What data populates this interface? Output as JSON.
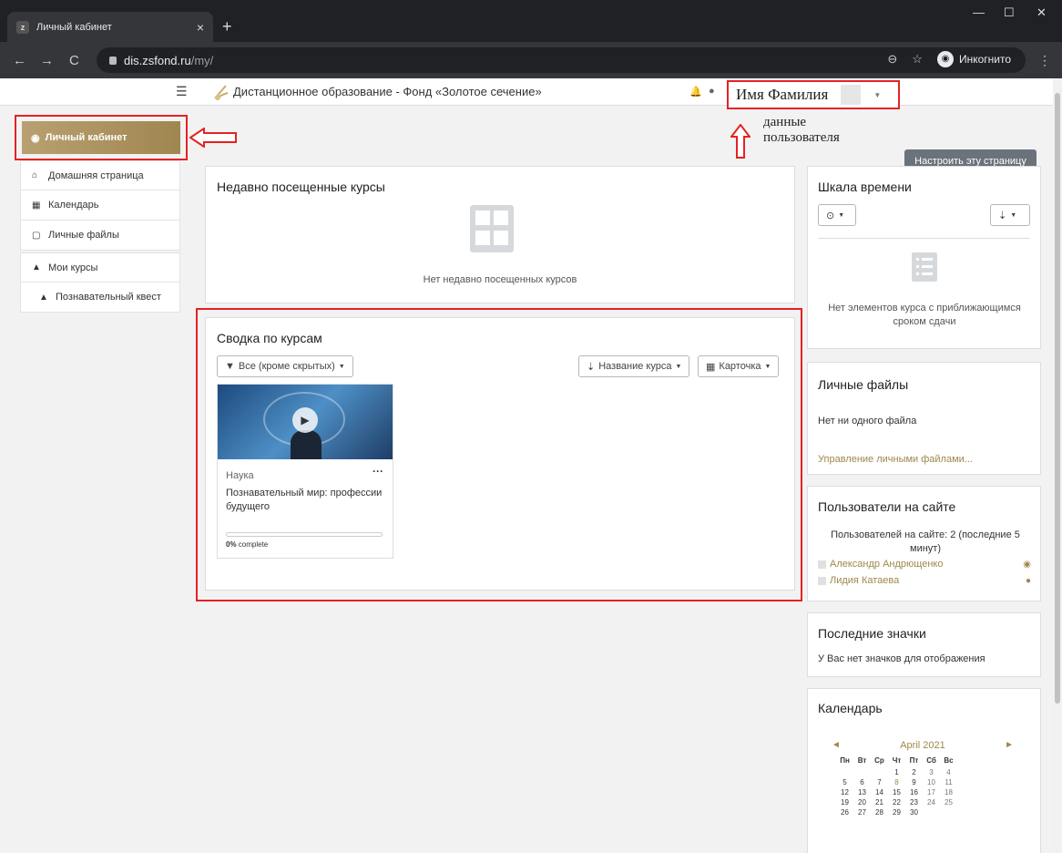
{
  "browser": {
    "tab_title": "Личный кабинет",
    "tab_close": "×",
    "new_tab": "+",
    "url_host": "dis.zsfond.ru",
    "url_path": "/my/",
    "incognito_label": "Инкогнито"
  },
  "navbar": {
    "site_name": "Дистанционное образование - Фонд «Золотое сечение»",
    "user_name": "Имя Фамилия"
  },
  "annotation": {
    "user_data_line1": "данные",
    "user_data_line2": "пользователя"
  },
  "customize_button": "Настроить эту страницу",
  "sidebar": {
    "active": "Личный кабинет",
    "items": [
      {
        "label": "Домашняя страница"
      },
      {
        "label": "Календарь"
      },
      {
        "label": "Личные файлы"
      },
      {
        "label": "Мои курсы"
      },
      {
        "label": "Познавательный квест"
      }
    ]
  },
  "recent": {
    "title": "Недавно посещенные курсы",
    "empty": "Нет недавно посещенных курсов"
  },
  "overview": {
    "title": "Сводка по курсам",
    "filter": "Все (кроме скрытых)",
    "sort": "Название курса",
    "view": "Карточка",
    "course": {
      "category": "Наука",
      "name": "Познавательный мир: профессии будущего",
      "progress_value": "0%",
      "progress_label": "complete",
      "progress_fraction": 0
    }
  },
  "timeline": {
    "title": "Шкала времени",
    "empty": "Нет элементов курса с приближающимся сроком сдачи"
  },
  "private_files": {
    "title": "Личные файлы",
    "empty": "Нет ни одного файла",
    "manage": "Управление личными файлами..."
  },
  "online": {
    "title": "Пользователи на сайте",
    "summary": "Пользователей на сайте: 2 (последние 5 минут)",
    "users": [
      "Александр Андрющенко",
      "Лидия Катаева"
    ]
  },
  "badges": {
    "title": "Последние значки",
    "empty": "У Вас нет значков для отображения"
  },
  "calendar": {
    "title": "Календарь",
    "month": "April 2021",
    "prev": "◄",
    "next": "►",
    "weekdays": [
      "Пн",
      "Вт",
      "Ср",
      "Чт",
      "Пт",
      "Сб",
      "Вс"
    ],
    "weeks": [
      [
        "",
        "",
        "",
        "1",
        "2",
        "3",
        "4"
      ],
      [
        "5",
        "6",
        "7",
        "8",
        "9",
        "10",
        "11"
      ],
      [
        "12",
        "13",
        "14",
        "15",
        "16",
        "17",
        "18"
      ],
      [
        "19",
        "20",
        "21",
        "22",
        "23",
        "24",
        "25"
      ],
      [
        "26",
        "27",
        "28",
        "29",
        "30",
        "",
        ""
      ]
    ]
  },
  "colors": {
    "accent": "#a08650",
    "highlight_red": "#e52222",
    "button_gray": "#6a737b"
  }
}
